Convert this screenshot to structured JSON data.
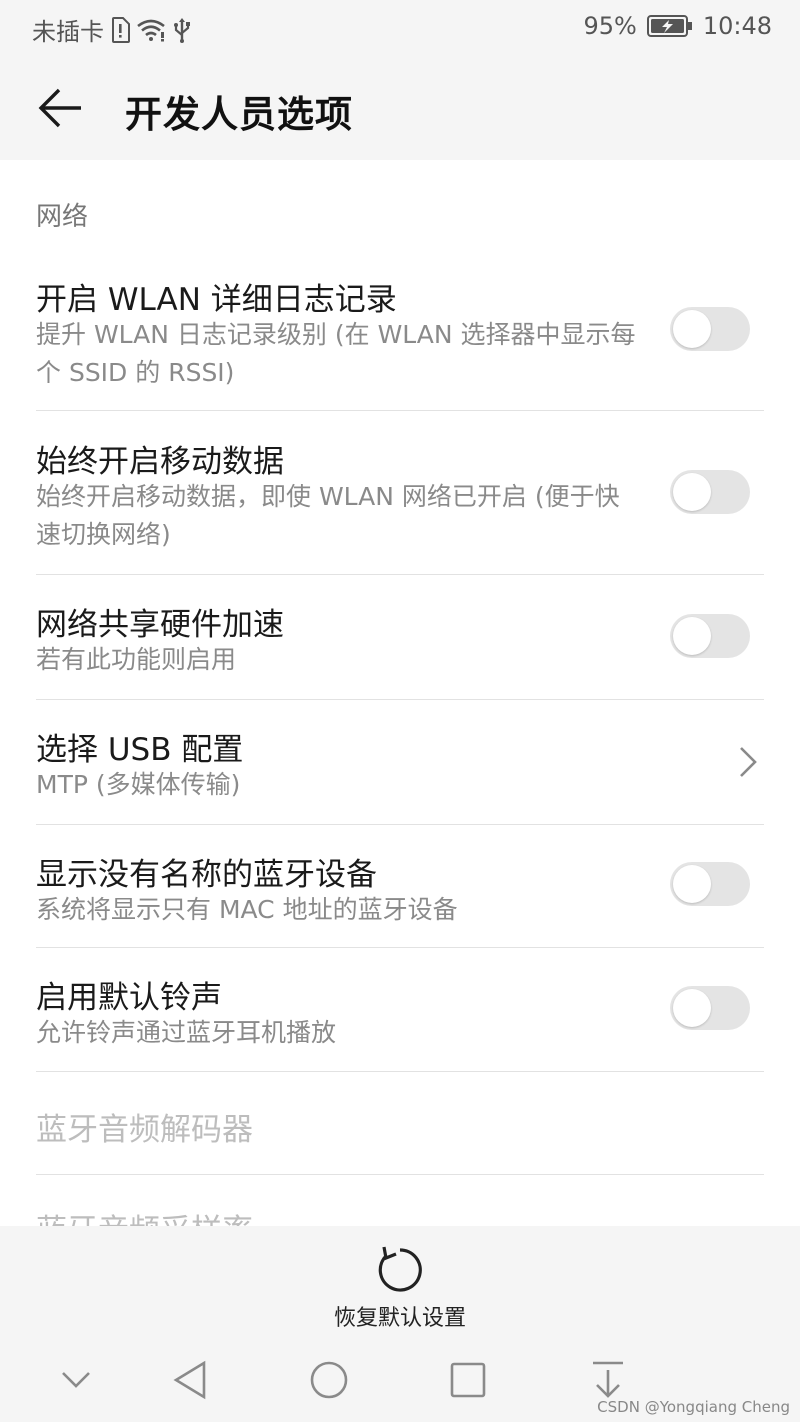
{
  "status_bar": {
    "carrier": "未插卡",
    "battery_percent": "95%",
    "time": "10:48",
    "icons": [
      "sim-alert-icon",
      "wifi-icon",
      "usb-icon",
      "battery-charging-icon"
    ]
  },
  "header": {
    "title": "开发人员选项",
    "back_icon": "back-arrow-icon"
  },
  "section": {
    "label": "网络"
  },
  "settings": [
    {
      "title": "开启 WLAN 详细日志记录",
      "subtitle": "提升 WLAN 日志记录级别 (在 WLAN 选择器中显示每个 SSID 的 RSSI)",
      "control": "toggle",
      "on": false
    },
    {
      "title": "始终开启移动数据",
      "subtitle": "始终开启移动数据，即使 WLAN 网络已开启 (便于快速切换网络)",
      "control": "toggle",
      "on": false
    },
    {
      "title": "网络共享硬件加速",
      "subtitle": "若有此功能则启用",
      "control": "toggle",
      "on": false
    },
    {
      "title": "选择 USB 配置",
      "subtitle": "MTP (多媒体传输)",
      "control": "chevron"
    },
    {
      "title": "显示没有名称的蓝牙设备",
      "subtitle": "系统将显示只有 MAC 地址的蓝牙设备",
      "control": "toggle",
      "on": false
    },
    {
      "title": "启用默认铃声",
      "subtitle": "允许铃声通过蓝牙耳机播放",
      "control": "toggle",
      "on": false
    },
    {
      "title": "蓝牙音频解码器",
      "subtitle": "",
      "control": "none",
      "disabled": true
    },
    {
      "title": "蓝牙音频采样率",
      "subtitle": "",
      "control": "none",
      "disabled": true
    }
  ],
  "bottom_action": {
    "label": "恢复默认设置",
    "icon": "restore-icon"
  },
  "nav_bar": {
    "icons": [
      "chevron-down-icon",
      "back-triangle-icon",
      "home-circle-icon",
      "recents-square-icon",
      "notification-pull-icon"
    ]
  },
  "watermark": "CSDN @Yongqiang Cheng",
  "colors": {
    "background": "#ffffff",
    "bar_background": "#f5f5f5",
    "toggle_off_track": "#e4e4e4",
    "secondary_text": "#8a8a8a",
    "divider": "#e2e2e2"
  }
}
